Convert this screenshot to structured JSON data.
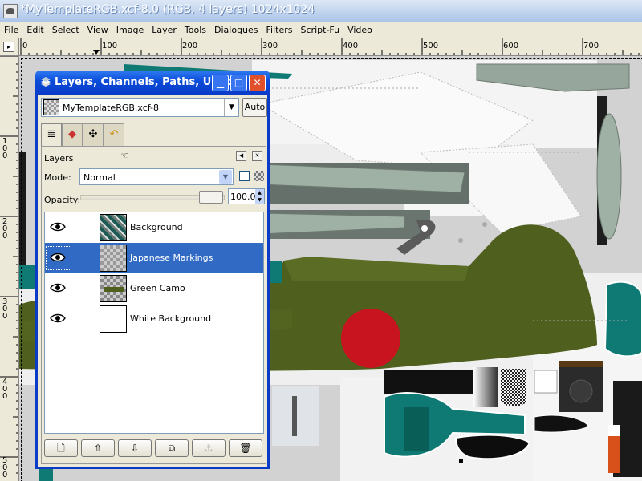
{
  "window": {
    "title": "*MyTemplateRGB.xcf-8.0 (RGB, 4 layers) 1024x1024"
  },
  "menu": [
    "File",
    "Edit",
    "Select",
    "View",
    "Image",
    "Layer",
    "Tools",
    "Dialogues",
    "Filters",
    "Script-Fu",
    "Video"
  ],
  "ruler": {
    "top_ticks": [
      "0",
      "100",
      "200",
      "300",
      "400",
      "500",
      "600",
      "700"
    ],
    "left_ticks": [
      "100",
      "200",
      "300",
      "400",
      "500"
    ]
  },
  "dialog": {
    "title": "Layers, Channels, Paths, Undo",
    "image_select": "MyTemplateRGB.xcf-8",
    "auto_label": "Auto",
    "panel_label": "Layers",
    "mode_label": "Mode:",
    "mode_value": "Normal",
    "opacity_label": "Opacity:",
    "opacity_value": "100.0",
    "opacity_level": 1.0,
    "layers": [
      {
        "name": "Background",
        "visible": true,
        "selected": false,
        "thumb": "texture"
      },
      {
        "name": "Japanese Markings",
        "visible": true,
        "selected": true,
        "thumb": "transparent"
      },
      {
        "name": "Green Camo",
        "visible": true,
        "selected": false,
        "thumb": "camo"
      },
      {
        "name": "White Background",
        "visible": true,
        "selected": false,
        "thumb": "white"
      }
    ],
    "buttons": {
      "new": "new-layer-icon",
      "raise": "raise-icon",
      "lower": "lower-icon",
      "duplicate": "duplicate-icon",
      "anchor": "anchor-icon",
      "delete": "trash-icon"
    }
  },
  "colors": {
    "accent": "#0a3cc8",
    "selection": "#316ac5",
    "camo_green": "#4e5f1e",
    "hinomaru_red": "#c8141e",
    "teal": "#0e7a73"
  }
}
